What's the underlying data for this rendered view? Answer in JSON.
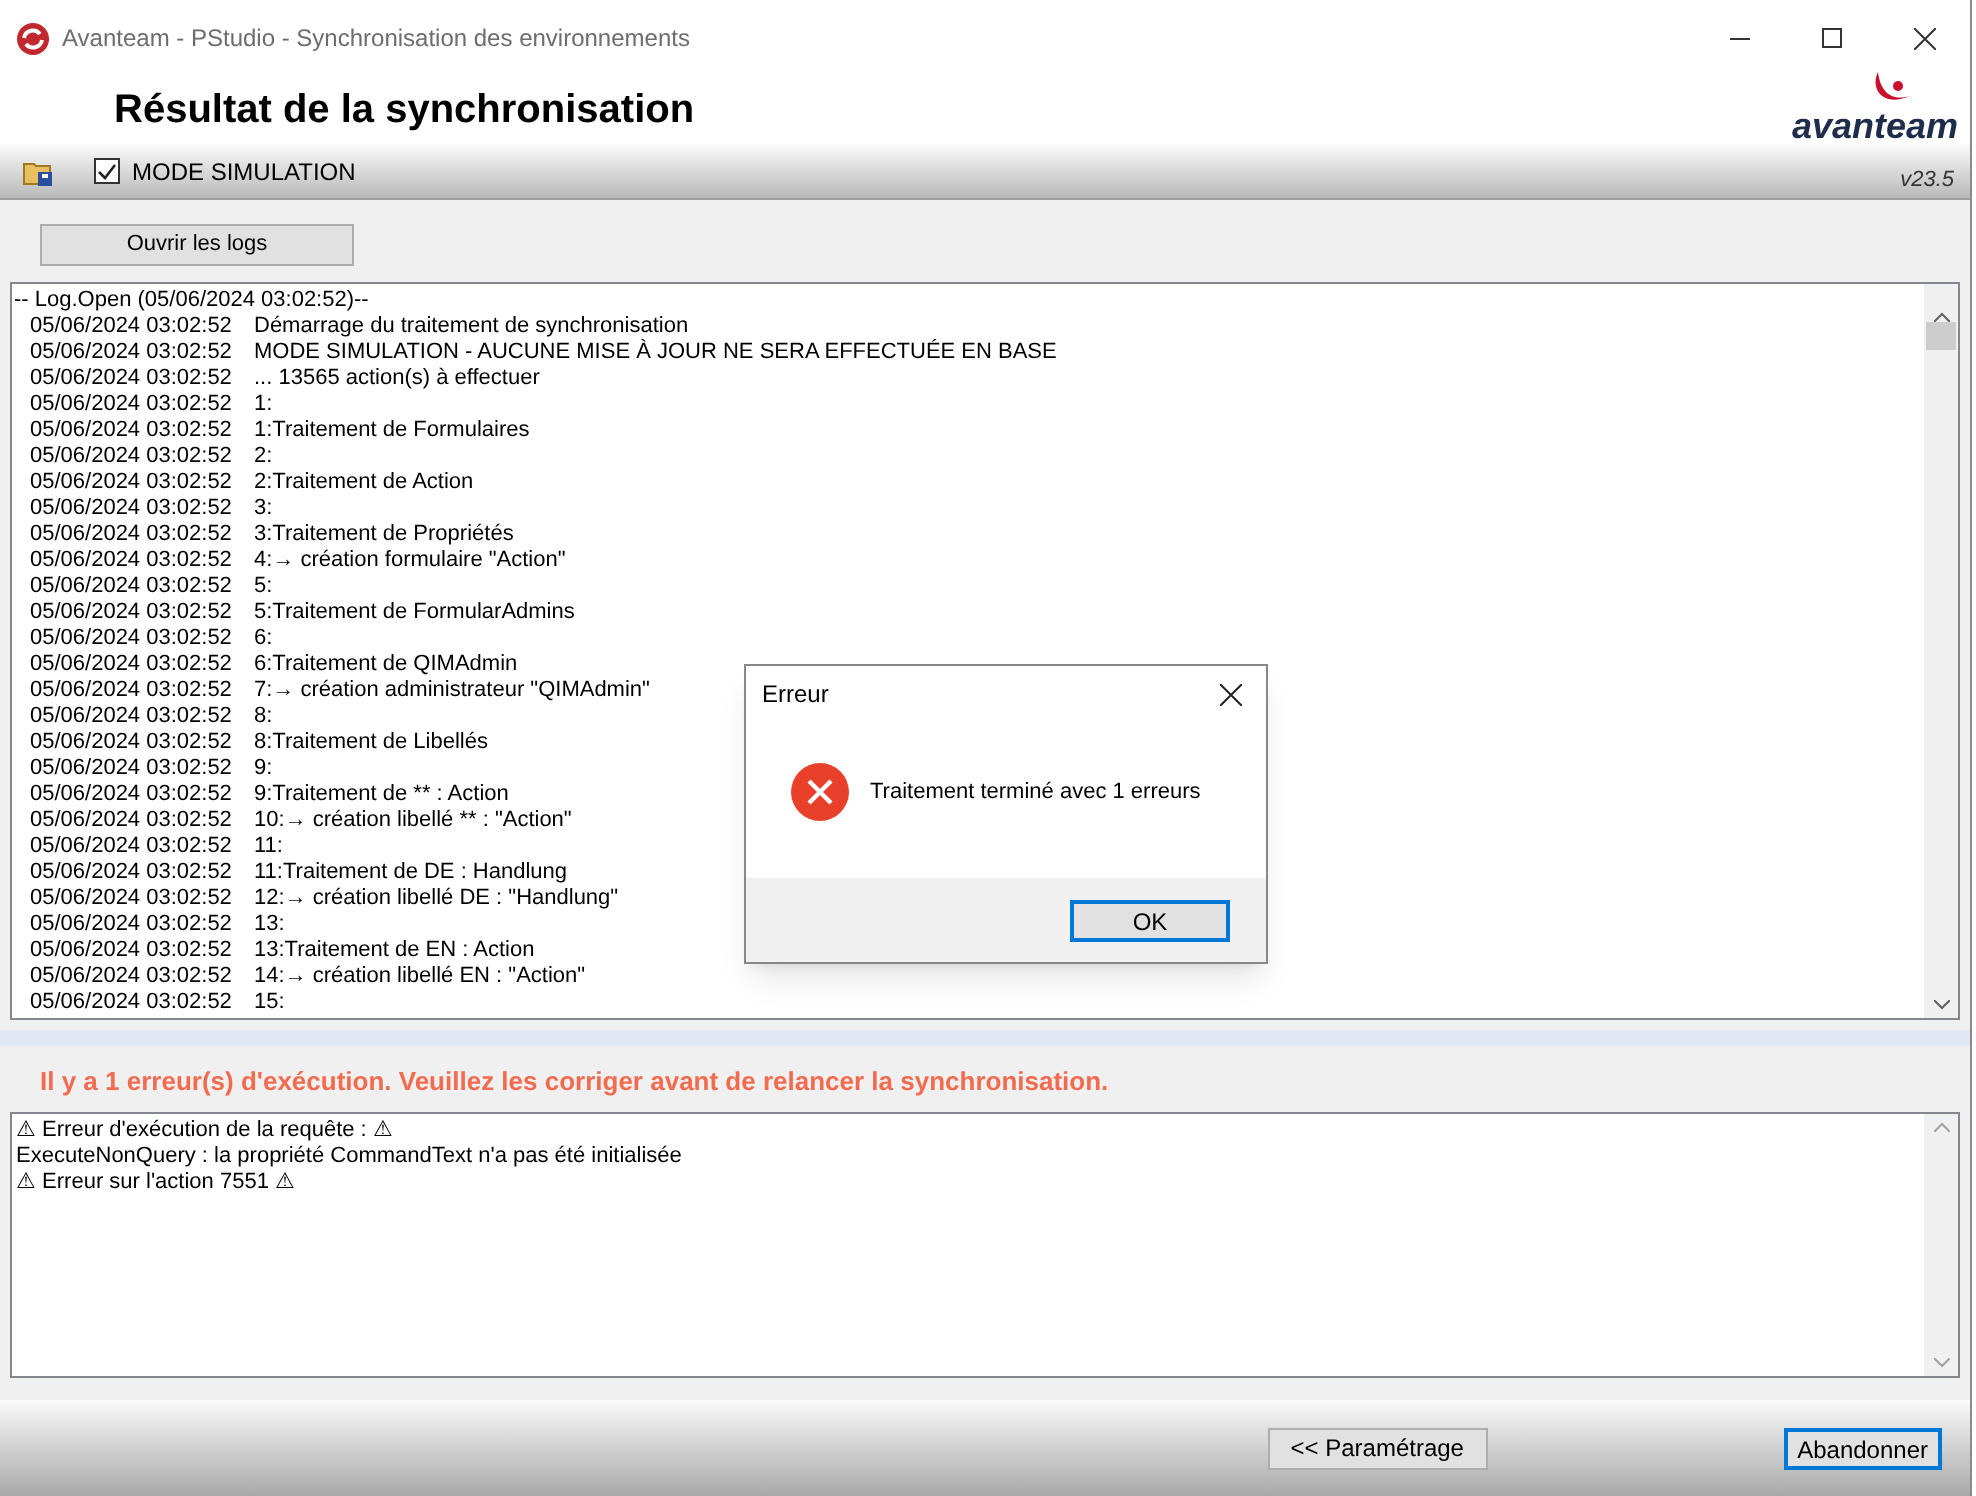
{
  "window": {
    "title": "Avanteam - PStudio - Synchronisation des environnements"
  },
  "header": {
    "title": "Résultat de la synchronisation",
    "logo": "avanteam",
    "version": "v23.5"
  },
  "toolbar": {
    "simulation": {
      "label": "MODE SIMULATION",
      "checked": true
    }
  },
  "open_logs_button": "Ouvrir les logs",
  "log": {
    "header": "-- Log.Open (05/06/2024 03:02:52)--",
    "lines": [
      {
        "time": "05/06/2024 03:02:52",
        "message": "Démarrage du traitement de synchronisation"
      },
      {
        "time": "05/06/2024 03:02:52",
        "message": "MODE SIMULATION - AUCUNE MISE À JOUR NE SERA EFFECTUÉE EN BASE"
      },
      {
        "time": "05/06/2024 03:02:52",
        "message": "... 13565 action(s) à effectuer"
      },
      {
        "time": "05/06/2024 03:02:52",
        "message": "1:"
      },
      {
        "time": "05/06/2024 03:02:52",
        "message": "1:Traitement de Formulaires"
      },
      {
        "time": "05/06/2024 03:02:52",
        "message": "2:"
      },
      {
        "time": "05/06/2024 03:02:52",
        "message": "2:Traitement de Action"
      },
      {
        "time": "05/06/2024 03:02:52",
        "message": "3:"
      },
      {
        "time": "05/06/2024 03:02:52",
        "message": "3:Traitement de Propriétés"
      },
      {
        "time": "05/06/2024 03:02:52",
        "message": "4:→ création formulaire \"Action\""
      },
      {
        "time": "05/06/2024 03:02:52",
        "message": "5:"
      },
      {
        "time": "05/06/2024 03:02:52",
        "message": "5:Traitement de FormularAdmins"
      },
      {
        "time": "05/06/2024 03:02:52",
        "message": "6:"
      },
      {
        "time": "05/06/2024 03:02:52",
        "message": "6:Traitement de QIMAdmin"
      },
      {
        "time": "05/06/2024 03:02:52",
        "message": "7:→ création administrateur \"QIMAdmin\""
      },
      {
        "time": "05/06/2024 03:02:52",
        "message": "8:"
      },
      {
        "time": "05/06/2024 03:02:52",
        "message": "8:Traitement de Libellés"
      },
      {
        "time": "05/06/2024 03:02:52",
        "message": "9:"
      },
      {
        "time": "05/06/2024 03:02:52",
        "message": "9:Traitement de ** : Action"
      },
      {
        "time": "05/06/2024 03:02:52",
        "message": "10:→ création libellé ** : \"Action\""
      },
      {
        "time": "05/06/2024 03:02:52",
        "message": "11:"
      },
      {
        "time": "05/06/2024 03:02:52",
        "message": "11:Traitement de DE : Handlung"
      },
      {
        "time": "05/06/2024 03:02:52",
        "message": "12:→ création libellé DE : \"Handlung\""
      },
      {
        "time": "05/06/2024 03:02:52",
        "message": "13:"
      },
      {
        "time": "05/06/2024 03:02:52",
        "message": "13:Traitement de EN : Action"
      },
      {
        "time": "05/06/2024 03:02:52",
        "message": "14:→ création libellé EN : \"Action\""
      },
      {
        "time": "05/06/2024 03:02:52",
        "message": "15:"
      }
    ]
  },
  "error_summary": "Il y a 1 erreur(s) d'exécution. Veuillez les corriger avant de relancer la synchronisation.",
  "error_details": [
    "⚠ Erreur d'exécution de la requête :  ⚠",
    "ExecuteNonQuery : la propriété CommandText n'a pas été initialisée",
    "⚠ Erreur sur l'action 7551 ⚠"
  ],
  "footer": {
    "buttons": [
      {
        "label": "<< Paramétrage",
        "default": false
      },
      {
        "label": "Abandonner",
        "default": true
      }
    ]
  },
  "dialog": {
    "title": "Erreur",
    "message": "Traitement terminé avec 1 erreurs",
    "button": "OK"
  }
}
